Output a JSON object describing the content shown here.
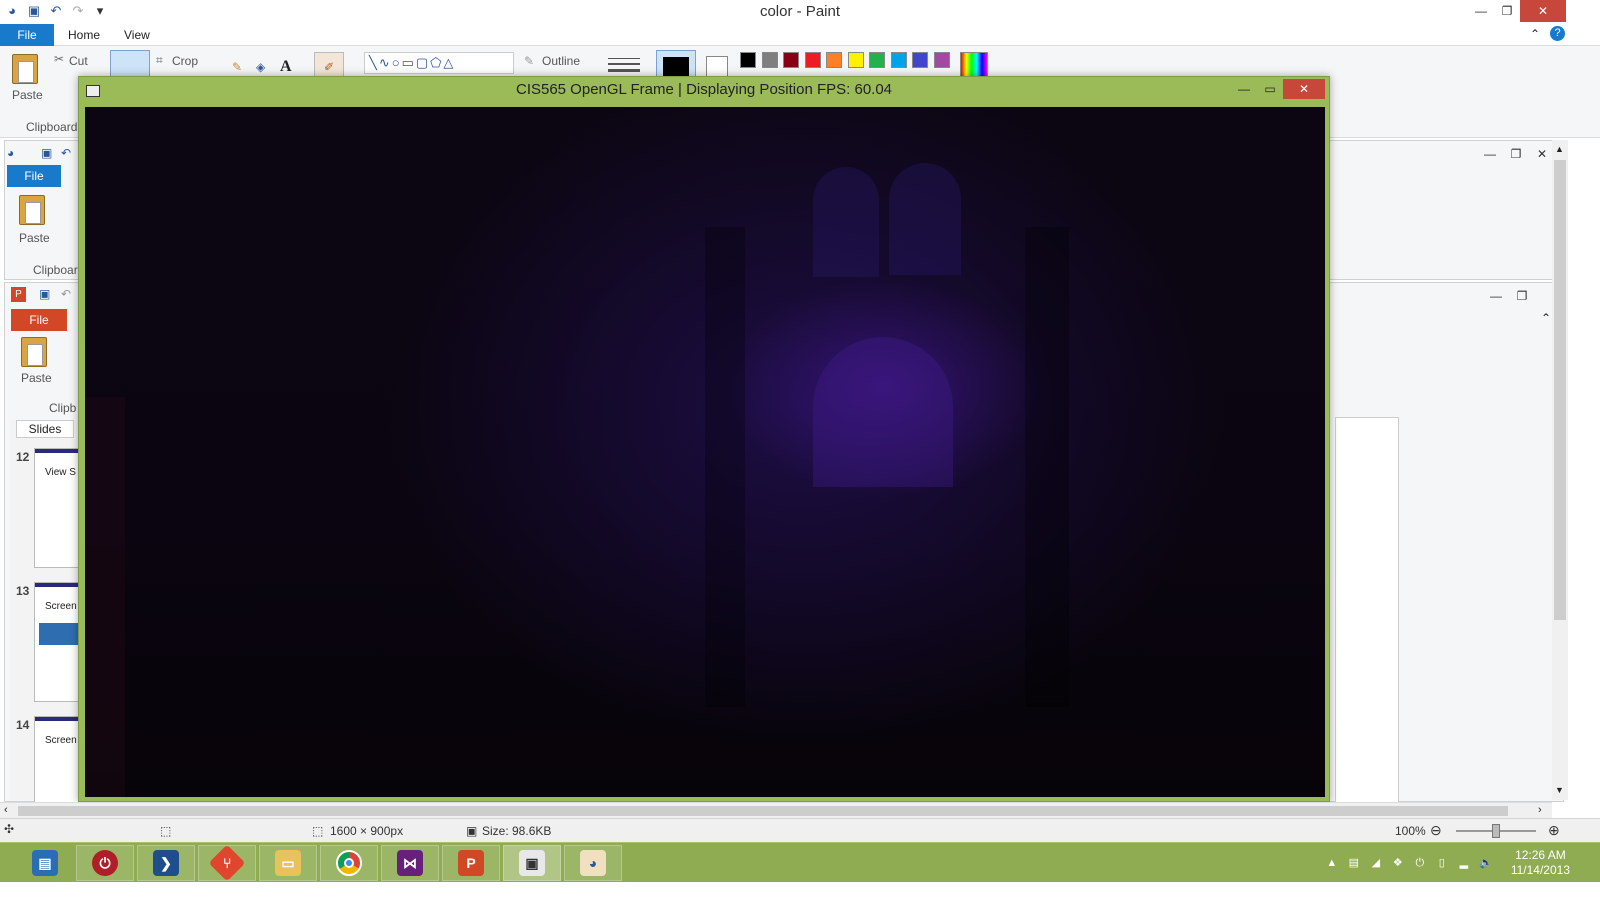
{
  "paint": {
    "title": "color - Paint",
    "tabs": {
      "file": "File",
      "home": "Home",
      "view": "View"
    },
    "ribbon": {
      "paste": "Paste",
      "cut": "Cut",
      "crop": "Crop",
      "outline": "Outline",
      "clipboard_group": "Clipboard"
    },
    "palette": [
      "#000000",
      "#7f7f7f",
      "#880015",
      "#ed1c24",
      "#ff7f27",
      "#fff200",
      "#22b14c",
      "#00a2e8",
      "#3f48cc",
      "#a349a4"
    ],
    "status": {
      "dimensions": "1600 × 900px",
      "size": "Size: 98.6KB",
      "zoom": "100%"
    }
  },
  "second_window": {
    "file_tab": "File",
    "paste": "Paste",
    "clipboard_group": "Clipboar"
  },
  "powerpoint": {
    "file_tab": "File",
    "paste": "Paste",
    "clipboard_group": "Clipb",
    "slides_tab": "Slides",
    "slides": [
      {
        "number": "12",
        "text": "View S"
      },
      {
        "number": "13",
        "text": "Screen S"
      },
      {
        "number": "14",
        "text": "Screen S"
      }
    ]
  },
  "opengl_frame": {
    "title": "CIS565 OpenGL Frame | Displaying Position FPS: 60.04",
    "accent": "#9bbb59"
  },
  "taskbar": {
    "apps": [
      "server-manager-icon",
      "power-icon",
      "powershell-icon",
      "git-icon",
      "file-explorer-icon",
      "chrome-icon",
      "visual-studio-icon",
      "powerpoint-icon",
      "opengl-app-icon",
      "paint-icon"
    ],
    "clock": {
      "time": "12:26 AM",
      "date": "11/14/2013"
    }
  }
}
